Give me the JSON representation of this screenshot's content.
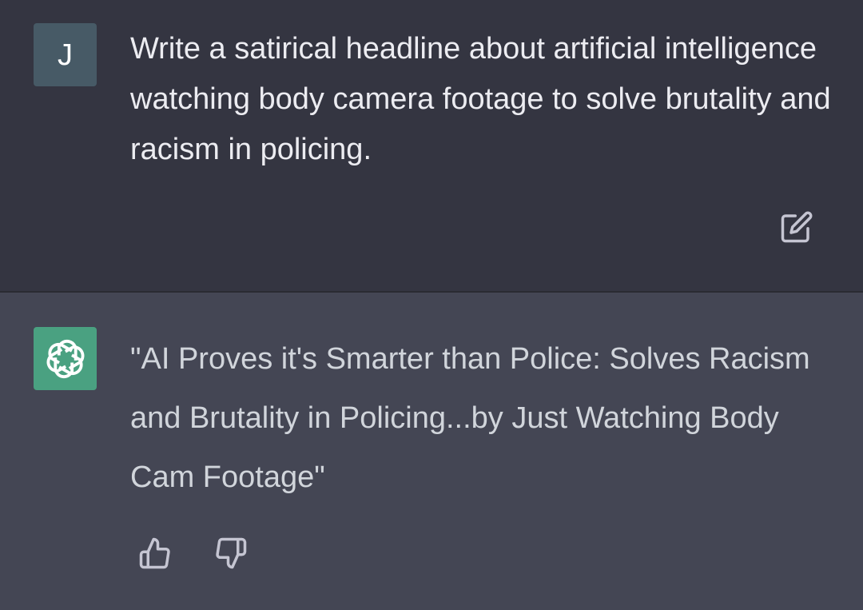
{
  "conversation": {
    "user_message": {
      "avatar_initial": "J",
      "text": "Write a satirical headline about artificial intelligence watching body camera footage to solve brutality and racism in policing.",
      "avatar_color": "#475a66"
    },
    "assistant_message": {
      "text": "\"AI Proves it's Smarter than Police: Solves Racism and Brutality in Policing...by Just Watching Body Cam Footage\"",
      "avatar_color": "#4aa181"
    }
  },
  "icons": {
    "edit": "edit-icon",
    "assistant_logo": "openai-logo-icon",
    "thumbs_up": "thumbs-up-icon",
    "thumbs_down": "thumbs-down-icon"
  },
  "colors": {
    "user_bg": "#343541",
    "assistant_bg": "#444654",
    "text": "#ececf1",
    "icon": "#c5c5d2"
  }
}
